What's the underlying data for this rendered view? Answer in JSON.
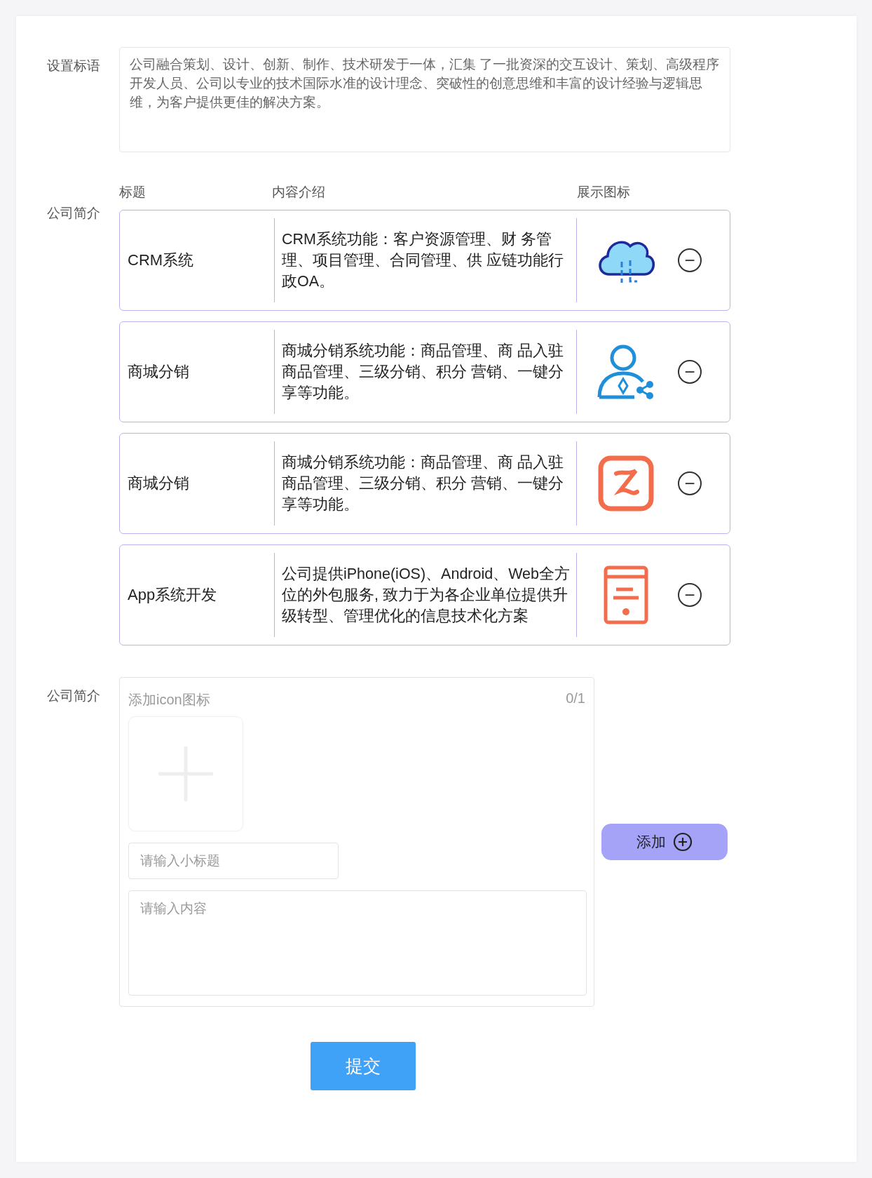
{
  "slogan": {
    "label": "设置标语",
    "value": "公司融合策划、设计、创新、制作、技术研发于一体，汇集 了一批资深的交互设计、策划、高级程序开发人员、公司以专业的技术国际水准的设计理念、突破性的创意思维和丰富的设计经验与逻辑思维，为客户提供更佳的解决方案。"
  },
  "intro": {
    "label": "公司简介",
    "columns": [
      "标题",
      "内容介绍",
      "展示图标"
    ],
    "rows": [
      {
        "title": "CRM系统",
        "content": "CRM系统功能：客户资源管理、财 务管理、项目管理、合同管理、供 应链功能行政OA。",
        "kind": "cloud",
        "remove": "−"
      },
      {
        "title": "商城分销",
        "content": "商城分销系统功能：商品管理、商 品入驻商品管理、三级分销、积分 营销、一键分享等功能。",
        "kind": "person",
        "remove": "−"
      },
      {
        "title": "商城分销",
        "content": "商城分销系统功能：商品管理、商 品入驻商品管理、三级分销、积分 营销、一键分享等功能。",
        "kind": "app",
        "remove": "−"
      },
      {
        "title": "App系统开发",
        "content": "公司提供iPhone(iOS)、Android、Web全方位的外包服务, 致力于为各企业单位提供升级转型、管理优化的信息技术化方案",
        "kind": "tablet",
        "remove": "−"
      }
    ]
  },
  "add_form": {
    "label": "公司简介",
    "upload_label": "添加icon图标",
    "count": "0/1",
    "title_placeholder": "请输入小标题",
    "content_placeholder": "请输入内容",
    "add_button": "添加"
  },
  "submit": "提交"
}
